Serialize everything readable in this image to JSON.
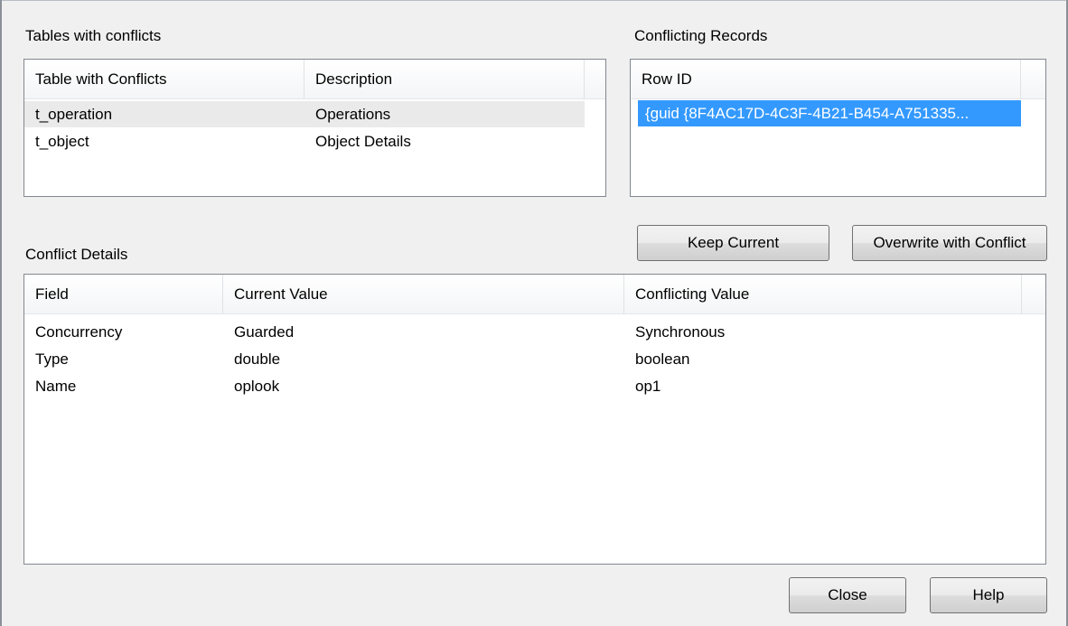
{
  "tables_panel": {
    "label": "Tables with conflicts",
    "columns": [
      "Table with Conflicts",
      "Description"
    ],
    "rows": [
      {
        "table": "t_operation",
        "description": "Operations"
      },
      {
        "table": "t_object",
        "description": "Object Details"
      }
    ]
  },
  "records_panel": {
    "label": "Conflicting Records",
    "column": "Row ID",
    "rows": [
      {
        "row_id": "{guid {8F4AC17D-4C3F-4B21-B454-A751335..."
      }
    ]
  },
  "actions": {
    "keep_current": "Keep Current",
    "overwrite": "Overwrite with Conflict"
  },
  "details_panel": {
    "label": "Conflict Details",
    "columns": [
      "Field",
      "Current Value",
      "Conflicting Value"
    ],
    "rows": [
      {
        "field": "Concurrency",
        "current": "Guarded",
        "conflicting": "Synchronous"
      },
      {
        "field": "Type",
        "current": "double",
        "conflicting": "boolean"
      },
      {
        "field": "Name",
        "current": "oplook",
        "conflicting": "op1"
      }
    ]
  },
  "footer": {
    "close": "Close",
    "help": "Help"
  },
  "colors": {
    "selection": "#3399ff",
    "window_bg": "#f0f0f0"
  }
}
